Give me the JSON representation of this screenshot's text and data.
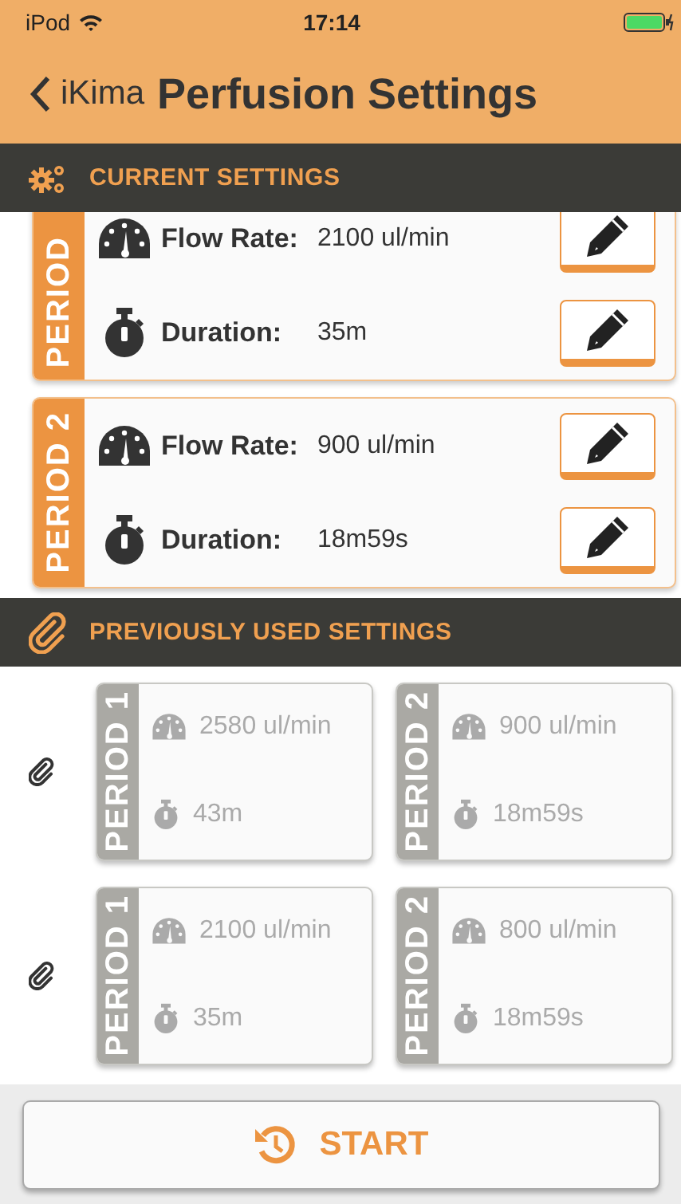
{
  "status_bar": {
    "carrier": "iPod",
    "time": "17:14"
  },
  "nav": {
    "back": "iKima",
    "title": "Perfusion Settings"
  },
  "current": {
    "title": "CURRENT SETTINGS",
    "periods": [
      {
        "label": "PERIOD",
        "flow_label": "Flow Rate:",
        "flow": "2100 ul/min",
        "duration_label": "Duration:",
        "duration": "35m",
        "clipped": true
      },
      {
        "label": "PERIOD 2",
        "flow_label": "Flow Rate:",
        "flow": "900 ul/min",
        "duration_label": "Duration:",
        "duration": "18m59s",
        "clipped": false
      }
    ]
  },
  "previous": {
    "title": "PREVIOUSLY USED SETTINGS",
    "rows": [
      {
        "periods": [
          {
            "label": "PERIOD 1",
            "flow": "2580 ul/min",
            "duration": "43m"
          },
          {
            "label": "PERIOD 2",
            "flow": "900 ul/min",
            "duration": "18m59s"
          }
        ]
      },
      {
        "periods": [
          {
            "label": "PERIOD 1",
            "flow": "2100 ul/min",
            "duration": "35m"
          },
          {
            "label": "PERIOD 2",
            "flow": "800 ul/min",
            "duration": "18m59s"
          }
        ]
      }
    ]
  },
  "start_button": {
    "label": "START"
  }
}
